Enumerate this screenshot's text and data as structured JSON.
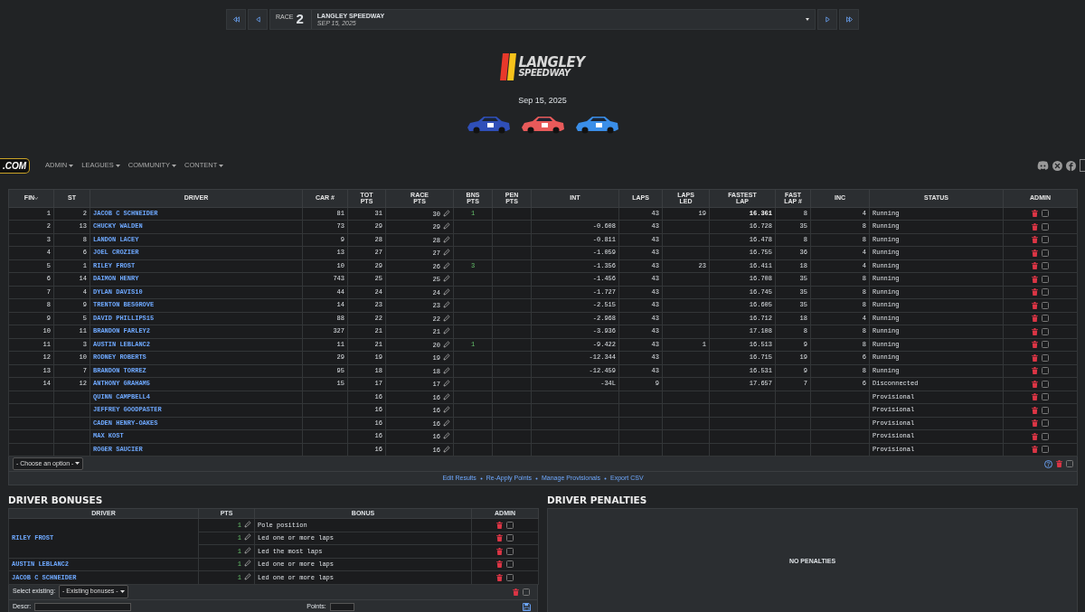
{
  "race_selector": {
    "race_label": "RACE",
    "race_number": "2",
    "track": "LANGLEY SPEEDWAY",
    "date": "SEP 15, 2025"
  },
  "event": {
    "logo_top": "LANGLEY",
    "logo_bottom": "SPEEDWAY",
    "date": "Sep 15, 2025",
    "cars": [
      {
        "color": "#2f4fb8"
      },
      {
        "color": "#e85a5a"
      },
      {
        "color": "#3a8ee8"
      }
    ]
  },
  "navbar": {
    "brand": ".COM",
    "menu": [
      "ADMIN",
      "LEAGUES",
      "COMMUNITY",
      "CONTENT"
    ]
  },
  "results": {
    "columns": [
      [
        "FIN"
      ],
      [
        "ST"
      ],
      [
        "DRIVER"
      ],
      [
        "CAR #"
      ],
      [
        "TOT",
        "PTS"
      ],
      [
        "RACE",
        "PTS"
      ],
      [
        "BNS",
        "PTS"
      ],
      [
        "PEN",
        "PTS"
      ],
      [
        "INT"
      ],
      [
        "LAPS"
      ],
      [
        "LAPS",
        "LED"
      ],
      [
        "FASTEST",
        "LAP"
      ],
      [
        "FAST",
        "LAP #"
      ],
      [
        "INC"
      ],
      [
        "STATUS"
      ],
      [
        "ADMIN"
      ]
    ],
    "rows": [
      {
        "fin": "1",
        "st": "2",
        "driver": "JACOB C SCHNEIDER",
        "car": "81",
        "tot": "31",
        "race": "30",
        "bns": "1",
        "int": "",
        "laps": "43",
        "led": "19",
        "fastest": "16.361",
        "fastest_overall": true,
        "fast_lap": "8",
        "inc": "4",
        "status": "Running",
        "checked": false
      },
      {
        "fin": "2",
        "st": "13",
        "driver": "CHUCKY WALDEN",
        "car": "73",
        "tot": "29",
        "race": "29",
        "bns": "",
        "int": "-0.608",
        "laps": "43",
        "led": "",
        "fastest": "16.728",
        "fastest_overall": false,
        "fast_lap": "35",
        "inc": "8",
        "status": "Running",
        "checked": false
      },
      {
        "fin": "3",
        "st": "8",
        "driver": "LANDON LACEY",
        "car": "9",
        "tot": "28",
        "race": "28",
        "bns": "",
        "int": "-0.811",
        "laps": "43",
        "led": "",
        "fastest": "16.478",
        "fastest_overall": false,
        "fast_lap": "8",
        "inc": "8",
        "status": "Running",
        "checked": false
      },
      {
        "fin": "4",
        "st": "6",
        "driver": "JOEL CROZIER",
        "car": "13",
        "tot": "27",
        "race": "27",
        "bns": "",
        "int": "-1.059",
        "laps": "43",
        "led": "",
        "fastest": "16.755",
        "fastest_overall": false,
        "fast_lap": "36",
        "inc": "4",
        "status": "Running",
        "checked": false
      },
      {
        "fin": "5",
        "st": "1",
        "driver": "RILEY FROST",
        "car": "10",
        "tot": "29",
        "race": "26",
        "bns": "3",
        "int": "-1.356",
        "laps": "43",
        "led": "23",
        "fastest": "16.411",
        "fastest_overall": false,
        "fast_lap": "18",
        "inc": "4",
        "status": "Running",
        "checked": false
      },
      {
        "fin": "6",
        "st": "14",
        "driver": "DAIMON HENRY",
        "car": "743",
        "tot": "25",
        "race": "25",
        "bns": "",
        "int": "-1.456",
        "laps": "43",
        "led": "",
        "fastest": "16.708",
        "fastest_overall": false,
        "fast_lap": "35",
        "inc": "8",
        "status": "Running",
        "checked": false
      },
      {
        "fin": "7",
        "st": "4",
        "driver": "DYLAN DAVIS10",
        "car": "44",
        "tot": "24",
        "race": "24",
        "bns": "",
        "int": "-1.727",
        "laps": "43",
        "led": "",
        "fastest": "16.745",
        "fastest_overall": false,
        "fast_lap": "35",
        "inc": "8",
        "status": "Running",
        "checked": false
      },
      {
        "fin": "8",
        "st": "9",
        "driver": "TRENTON BESGROVE",
        "car": "14",
        "tot": "23",
        "race": "23",
        "bns": "",
        "int": "-2.515",
        "laps": "43",
        "led": "",
        "fastest": "16.605",
        "fastest_overall": false,
        "fast_lap": "35",
        "inc": "8",
        "status": "Running",
        "checked": false
      },
      {
        "fin": "9",
        "st": "5",
        "driver": "DAVID PHILLIPS15",
        "car": "88",
        "tot": "22",
        "race": "22",
        "bns": "",
        "int": "-2.968",
        "laps": "43",
        "led": "",
        "fastest": "16.712",
        "fastest_overall": false,
        "fast_lap": "18",
        "inc": "4",
        "status": "Running",
        "checked": false
      },
      {
        "fin": "10",
        "st": "11",
        "driver": "BRANDON FARLEY2",
        "car": "327",
        "tot": "21",
        "race": "21",
        "bns": "",
        "int": "-3.936",
        "laps": "43",
        "led": "",
        "fastest": "17.108",
        "fastest_overall": false,
        "fast_lap": "8",
        "inc": "8",
        "status": "Running",
        "checked": false
      },
      {
        "fin": "11",
        "st": "3",
        "driver": "AUSTIN LEBLANC2",
        "car": "11",
        "tot": "21",
        "race": "20",
        "bns": "1",
        "int": "-9.422",
        "laps": "43",
        "led": "1",
        "fastest": "16.513",
        "fastest_overall": false,
        "fast_lap": "9",
        "inc": "8",
        "status": "Running",
        "checked": false
      },
      {
        "fin": "12",
        "st": "10",
        "driver": "RODNEY ROBERTS",
        "car": "29",
        "tot": "19",
        "race": "19",
        "bns": "",
        "int": "-12.344",
        "laps": "43",
        "led": "",
        "fastest": "16.715",
        "fastest_overall": false,
        "fast_lap": "19",
        "inc": "6",
        "status": "Running",
        "checked": false
      },
      {
        "fin": "13",
        "st": "7",
        "driver": "BRANDON TORREZ",
        "car": "95",
        "tot": "18",
        "race": "18",
        "bns": "",
        "int": "-12.459",
        "laps": "43",
        "led": "",
        "fastest": "16.531",
        "fastest_overall": false,
        "fast_lap": "9",
        "inc": "8",
        "status": "Running",
        "checked": false
      },
      {
        "fin": "14",
        "st": "12",
        "driver": "ANTHONY GRAHAM5",
        "car": "15",
        "tot": "17",
        "race": "17",
        "bns": "",
        "int": "-34L",
        "laps": "9",
        "led": "",
        "fastest": "17.657",
        "fastest_overall": false,
        "fast_lap": "7",
        "inc": "6",
        "status": "Disconnected",
        "checked": false
      },
      {
        "fin": "",
        "st": "",
        "driver": "QUINN CAMPBELL4",
        "car": "",
        "tot": "16",
        "race": "16",
        "bns": "",
        "int": "",
        "laps": "",
        "led": "",
        "fastest": "",
        "fast_lap": "",
        "inc": "",
        "status": "Provisional",
        "checked": false
      },
      {
        "fin": "",
        "st": "",
        "driver": "JEFFREY GOODPASTER",
        "car": "",
        "tot": "16",
        "race": "16",
        "bns": "",
        "int": "",
        "laps": "",
        "led": "",
        "fastest": "",
        "fast_lap": "",
        "inc": "",
        "status": "Provisional",
        "checked": false
      },
      {
        "fin": "",
        "st": "",
        "driver": "CADEN HENRY-OAKES",
        "car": "",
        "tot": "16",
        "race": "16",
        "bns": "",
        "int": "",
        "laps": "",
        "led": "",
        "fastest": "",
        "fast_lap": "",
        "inc": "",
        "status": "Provisional",
        "checked": false
      },
      {
        "fin": "",
        "st": "",
        "driver": "MAX KOST",
        "car": "",
        "tot": "16",
        "race": "16",
        "bns": "",
        "int": "",
        "laps": "",
        "led": "",
        "fastest": "",
        "fast_lap": "",
        "inc": "",
        "status": "Provisional",
        "checked": false
      },
      {
        "fin": "",
        "st": "",
        "driver": "ROGER SAUCIER",
        "car": "",
        "tot": "16",
        "race": "16",
        "bns": "",
        "int": "",
        "laps": "",
        "led": "",
        "fastest": "",
        "fast_lap": "",
        "inc": "",
        "status": "Provisional",
        "checked": false
      }
    ],
    "bulk_select": {
      "value": "- Choose an option -",
      "checked": false
    },
    "links": [
      "Edit Results",
      "Re-Apply Points",
      "Manage Provisionals",
      "Export CSV"
    ]
  },
  "bonuses": {
    "title": "DRIVER BONUSES",
    "columns": [
      "DRIVER",
      "PTS",
      "BONUS",
      "ADMIN"
    ],
    "groups": [
      {
        "driver": "RILEY FROST",
        "items": [
          {
            "pts": "1",
            "bonus": "Pole position",
            "checked": false
          },
          {
            "pts": "1",
            "bonus": "Led one or more laps",
            "checked": false
          },
          {
            "pts": "1",
            "bonus": "Led the most laps",
            "checked": false
          }
        ]
      },
      {
        "driver": "AUSTIN LEBLANC2",
        "items": [
          {
            "pts": "1",
            "bonus": "Led one or more laps",
            "checked": false
          }
        ]
      },
      {
        "driver": "JACOB C SCHNEIDER",
        "items": [
          {
            "pts": "1",
            "bonus": "Led one or more laps",
            "checked": false
          }
        ]
      }
    ],
    "select_label": "Select existing:",
    "select_value": "- Existing bonuses -",
    "select_checked": false,
    "descr_label": "Descr:",
    "points_label": "Points:"
  },
  "penalties": {
    "title": "DRIVER PENALTIES",
    "empty": "NO PENALTIES"
  }
}
